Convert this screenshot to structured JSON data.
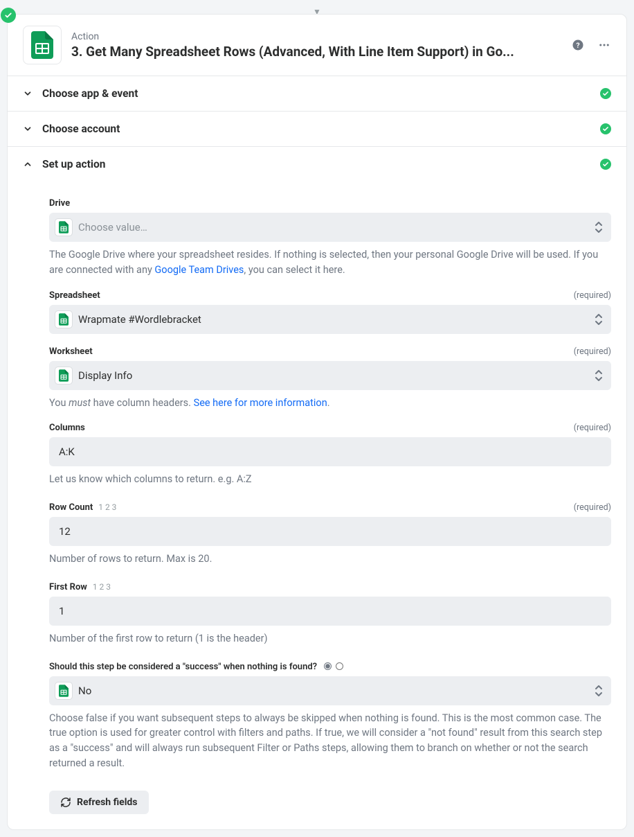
{
  "header": {
    "overline": "Action",
    "title": "3. Get Many Spreadsheet Rows (Advanced, With Line Item Support) in Go..."
  },
  "sections": {
    "appEvent": {
      "label": "Choose app & event"
    },
    "account": {
      "label": "Choose account"
    },
    "setup": {
      "label": "Set up action"
    }
  },
  "fields": {
    "drive": {
      "label": "Drive",
      "placeholder": "Choose value…",
      "helper_pre": "The Google Drive where your spreadsheet resides. If nothing is selected, then your personal Google Drive will be used. If you are connected with any ",
      "helper_link": "Google Team Drives",
      "helper_post": ", you can select it here."
    },
    "spreadsheet": {
      "label": "Spreadsheet",
      "required": "(required)",
      "value": "Wrapmate #Wordlebracket"
    },
    "worksheet": {
      "label": "Worksheet",
      "required": "(required)",
      "value": "Display Info",
      "helper_pre": "You ",
      "helper_em": "must",
      "helper_mid": " have column headers. ",
      "helper_link": "See here for more information",
      "helper_post": "."
    },
    "columns": {
      "label": "Columns",
      "required": "(required)",
      "value": "A:K",
      "helper": "Let us know which columns to return. e.g. A:Z"
    },
    "rowcount": {
      "label": "Row Count",
      "suffix": "1 2 3",
      "required": "(required)",
      "value": "12",
      "helper": "Number of rows to return. Max is 20."
    },
    "firstrow": {
      "label": "First Row",
      "suffix": "1 2 3",
      "value": "1",
      "helper": "Number of the first row to return (1 is the header)"
    },
    "success": {
      "label": "Should this step be considered a \"success\" when nothing is found?",
      "value": "No",
      "helper": "Choose false if you want subsequent steps to always be skipped when nothing is found. This is the most common case. The true option is used for greater control with filters and paths. If true, we will consider a \"not found\" result from this search step as a \"success\" and will always run subsequent Filter or Paths steps, allowing them to branch on whether or not the search returned a result."
    }
  },
  "refresh": "Refresh fields"
}
